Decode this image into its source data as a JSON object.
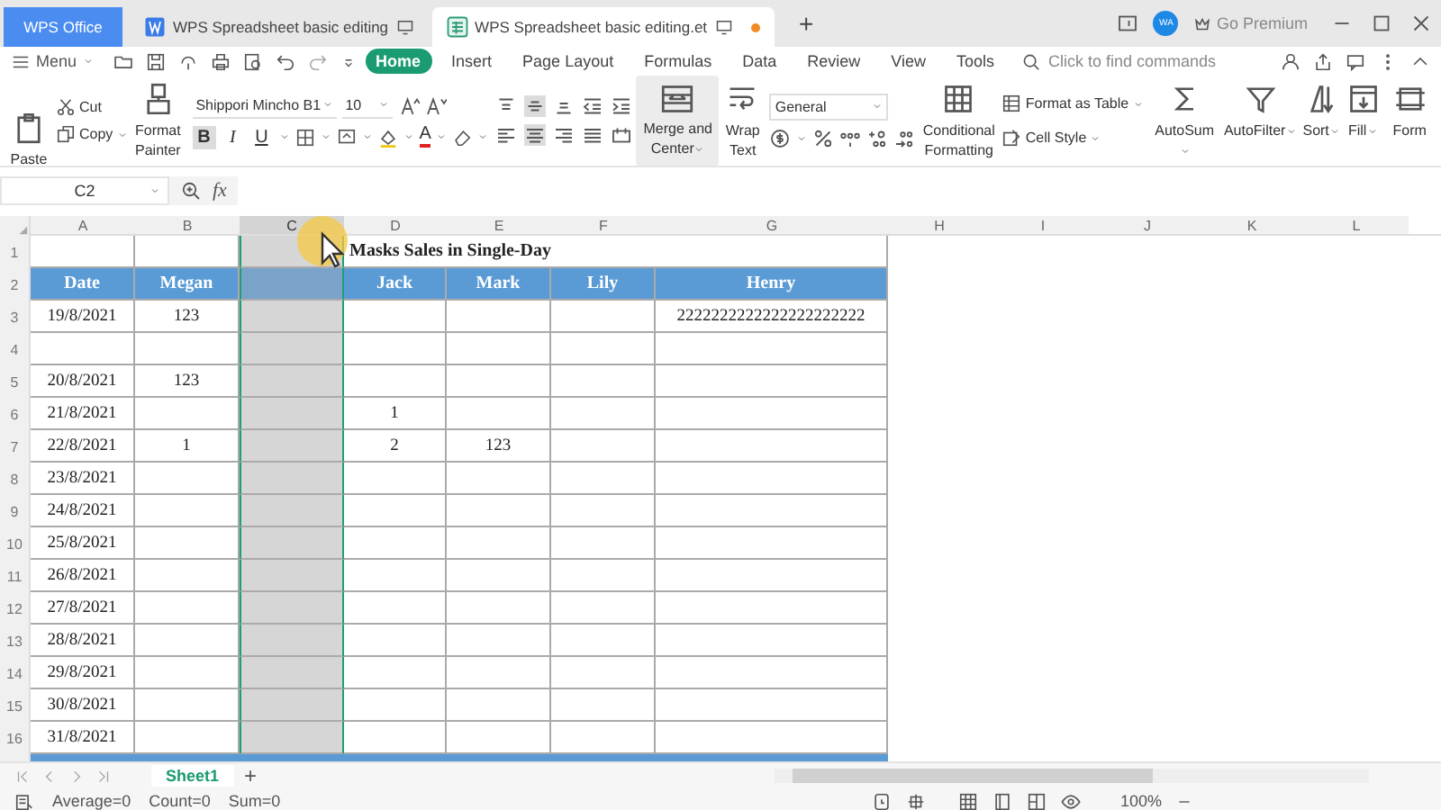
{
  "title_bar": {
    "tabs": [
      {
        "kind": "home",
        "label": "WPS Office",
        "selected": false,
        "modified": false
      },
      {
        "kind": "writer",
        "label": "WPS Spreadsheet basic editing",
        "selected": false,
        "modified": false
      },
      {
        "kind": "sheet",
        "label": "WPS Spreadsheet basic editing.et",
        "selected": true,
        "modified": true
      }
    ],
    "new_tab": "+",
    "avatar": "WA",
    "premium": "Go Premium"
  },
  "menu_bar": {
    "menu": "Menu",
    "ribbon_tabs": [
      {
        "label": "Home",
        "selected": true
      },
      {
        "label": "Insert",
        "selected": false
      },
      {
        "label": "Page Layout",
        "selected": false
      },
      {
        "label": "Formulas",
        "selected": false
      },
      {
        "label": "Data",
        "selected": false
      },
      {
        "label": "Review",
        "selected": false
      },
      {
        "label": "View",
        "selected": false
      },
      {
        "label": "Tools",
        "selected": false
      }
    ],
    "search": {
      "placeholder": "Click to find commands"
    }
  },
  "ribbon": {
    "paste": "Paste",
    "cut": "Cut",
    "copy": "Copy",
    "format_painter": "Format Painter",
    "font_name": "Shippori Mincho B1",
    "font_size": "10",
    "font_styles": [
      {
        "label": "B",
        "selected": true
      },
      {
        "label": "I",
        "selected": false
      },
      {
        "label": "U",
        "selected": false
      }
    ],
    "font_color": "A",
    "vertical_align": [
      {
        "kind": "top",
        "selected": false
      },
      {
        "kind": "middle",
        "selected": true
      },
      {
        "kind": "bottom",
        "selected": false
      }
    ],
    "horizontal_align": [
      {
        "kind": "left",
        "selected": false
      },
      {
        "kind": "center",
        "selected": true
      },
      {
        "kind": "right",
        "selected": false
      },
      {
        "kind": "justify",
        "selected": false
      }
    ],
    "merge": "Merge and Center",
    "wrap": "Wrap Text",
    "number_format": "General",
    "conditional_formatting": "Conditional Formatting",
    "format_as_table": "Format as Table",
    "cell_style": "Cell Style",
    "autosum": "AutoSum",
    "autofilter": "AutoFilter",
    "sort": "Sort",
    "fill": "Fill",
    "format": "Form"
  },
  "formula_bar": {
    "name_box": "C2",
    "fx": "fx"
  },
  "sheet": {
    "columns": [
      {
        "label": "A",
        "selected": false
      },
      {
        "label": "B",
        "selected": false
      },
      {
        "label": "C",
        "selected": true
      },
      {
        "label": "D",
        "selected": false
      },
      {
        "label": "E",
        "selected": false
      },
      {
        "label": "F",
        "selected": false
      },
      {
        "label": "G",
        "selected": false
      },
      {
        "label": "H",
        "selected": false
      },
      {
        "label": "I",
        "selected": false
      },
      {
        "label": "J",
        "selected": false
      },
      {
        "label": "K",
        "selected": false
      },
      {
        "label": "L",
        "selected": false
      }
    ],
    "rows": [
      {
        "number": "1",
        "kind": "title",
        "title": "Masks Sales in Single-Day"
      },
      {
        "number": "2",
        "kind": "header",
        "cells": [
          "Date",
          "Megan",
          null,
          "Jack",
          "Mark",
          "Lily",
          "Henry"
        ]
      },
      {
        "number": "3",
        "kind": "data",
        "cells": [
          "19/8/2021",
          "123",
          null,
          null,
          null,
          null,
          "2222222222222222222222"
        ]
      },
      {
        "number": "4",
        "kind": "data",
        "cells": [
          null,
          null,
          null,
          null,
          null,
          null,
          null
        ]
      },
      {
        "number": "5",
        "kind": "data",
        "cells": [
          "20/8/2021",
          "123",
          null,
          null,
          null,
          null,
          null
        ]
      },
      {
        "number": "6",
        "kind": "data",
        "cells": [
          "21/8/2021",
          null,
          null,
          "1",
          null,
          null,
          null
        ]
      },
      {
        "number": "7",
        "kind": "data",
        "cells": [
          "22/8/2021",
          "1",
          null,
          "2",
          "123",
          null,
          null
        ]
      },
      {
        "number": "8",
        "kind": "data",
        "cells": [
          "23/8/2021",
          null,
          null,
          null,
          null,
          null,
          null
        ]
      },
      {
        "number": "9",
        "kind": "data",
        "cells": [
          "24/8/2021",
          null,
          null,
          null,
          null,
          null,
          null
        ]
      },
      {
        "number": "10",
        "kind": "data",
        "cells": [
          "25/8/2021",
          null,
          null,
          null,
          null,
          null,
          null
        ]
      },
      {
        "number": "11",
        "kind": "data",
        "cells": [
          "26/8/2021",
          null,
          null,
          null,
          null,
          null,
          null
        ]
      },
      {
        "number": "12",
        "kind": "data",
        "cells": [
          "27/8/2021",
          null,
          null,
          null,
          null,
          null,
          null
        ]
      },
      {
        "number": "13",
        "kind": "data",
        "cells": [
          "28/8/2021",
          null,
          null,
          null,
          null,
          null,
          null
        ]
      },
      {
        "number": "14",
        "kind": "data",
        "cells": [
          "29/8/2021",
          null,
          null,
          null,
          null,
          null,
          null
        ]
      },
      {
        "number": "15",
        "kind": "data",
        "cells": [
          "30/8/2021",
          null,
          null,
          null,
          null,
          null,
          null
        ]
      },
      {
        "number": "16",
        "kind": "data",
        "cells": [
          "31/8/2021",
          null,
          null,
          null,
          null,
          null,
          null
        ]
      }
    ]
  },
  "sheet_tabs": [
    {
      "label": "Sheet1",
      "selected": true
    }
  ],
  "add_sheet": "+",
  "status_bar": {
    "stats": [
      "Average=0",
      "Count=0",
      "Sum=0"
    ],
    "zoom": "100%"
  }
}
